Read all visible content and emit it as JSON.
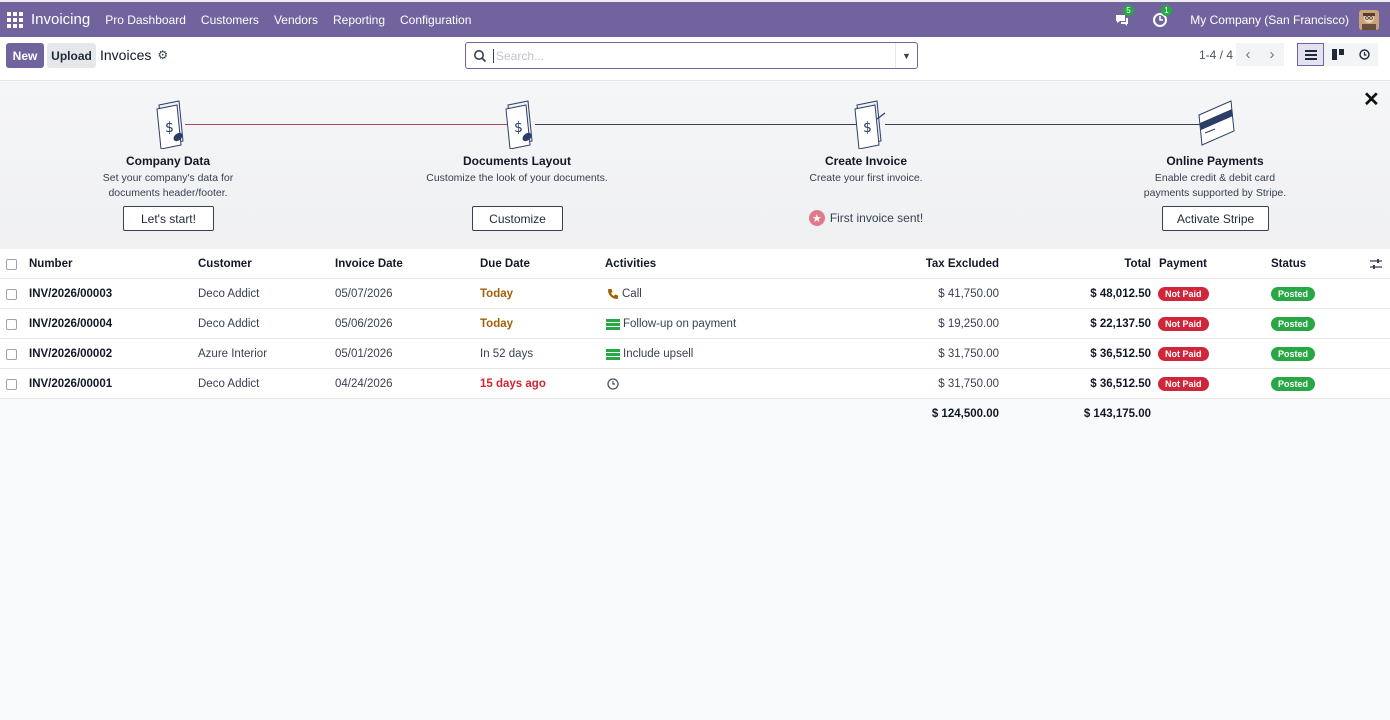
{
  "navbar": {
    "app_name": "Invoicing",
    "menu": [
      "Pro Dashboard",
      "Customers",
      "Vendors",
      "Reporting",
      "Configuration"
    ],
    "messages_count": "5",
    "activities_count": "1",
    "company": "My Company (San Francisco)"
  },
  "control_panel": {
    "new_label": "New",
    "upload_label": "Upload",
    "breadcrumb": "Invoices",
    "search_placeholder": "Search...",
    "pager": "1-4 / 4"
  },
  "onboarding": {
    "steps": [
      {
        "title": "Company Data",
        "desc": "Set your company's data for documents header/footer.",
        "button": "Let's start!"
      },
      {
        "title": "Documents Layout",
        "desc": "Customize the look of your documents.",
        "button": "Customize"
      },
      {
        "title": "Create Invoice",
        "desc": "Create your first invoice.",
        "done": "First invoice sent!"
      },
      {
        "title": "Online Payments",
        "desc": "Enable credit & debit card payments supported by Stripe.",
        "button": "Activate Stripe"
      }
    ]
  },
  "table": {
    "columns": {
      "number": "Number",
      "customer": "Customer",
      "invoice_date": "Invoice Date",
      "due_date": "Due Date",
      "activities": "Activities",
      "tax_excluded": "Tax Excluded",
      "total": "Total",
      "payment": "Payment",
      "status": "Status"
    },
    "rows": [
      {
        "number": "INV/2026/00003",
        "customer": "Deco Addict",
        "invoice_date": "05/07/2026",
        "due_date": "Today",
        "activity": "Call",
        "tax_excluded": "$ 41,750.00",
        "total": "$ 48,012.50",
        "payment": "Not Paid",
        "status": "Posted"
      },
      {
        "number": "INV/2026/00004",
        "customer": "Deco Addict",
        "invoice_date": "05/06/2026",
        "due_date": "Today",
        "activity": "Follow-up on payment",
        "tax_excluded": "$ 19,250.00",
        "total": "$ 22,137.50",
        "payment": "Not Paid",
        "status": "Posted"
      },
      {
        "number": "INV/2026/00002",
        "customer": "Azure Interior",
        "invoice_date": "05/01/2026",
        "due_date": "In 52 days",
        "activity": "Include upsell",
        "tax_excluded": "$ 31,750.00",
        "total": "$ 36,512.50",
        "payment": "Not Paid",
        "status": "Posted"
      },
      {
        "number": "INV/2026/00001",
        "customer": "Deco Addict",
        "invoice_date": "04/24/2026",
        "due_date": "15 days ago",
        "activity": "",
        "tax_excluded": "$ 31,750.00",
        "total": "$ 36,512.50",
        "payment": "Not Paid",
        "status": "Posted"
      }
    ],
    "totals": {
      "tax_excluded": "$ 124,500.00",
      "total": "$ 143,175.00"
    }
  },
  "colors": {
    "brand": "#71639e",
    "not_paid": "#d0263a",
    "posted": "#28a745",
    "due_today": "#a16207",
    "overdue": "#d0262f"
  }
}
